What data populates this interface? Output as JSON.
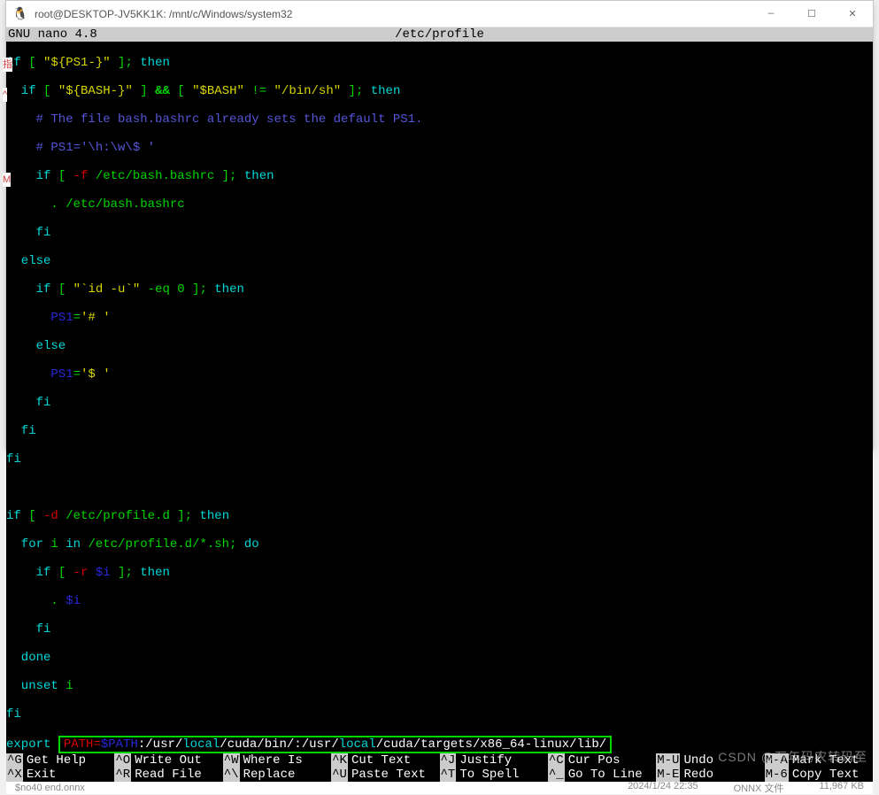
{
  "titlebar": {
    "icon": "🐧",
    "title": "root@DESKTOP-JV5KK1K: /mnt/c/Windows/system32",
    "min": "—",
    "max": "☐",
    "close": "✕"
  },
  "header": {
    "left": "  GNU nano 4.8",
    "center": "/etc/profile"
  },
  "code": {
    "l01_a": "if",
    "l01_b": " [ ",
    "l01_c": "\"${PS1-}\"",
    "l01_d": " ]; ",
    "l01_e": "then",
    "l02_a": "  if",
    "l02_b": " [ ",
    "l02_c": "\"${BASH-}\"",
    "l02_d": " ] ",
    "l02_e": "&&",
    "l02_f": " [ ",
    "l02_g": "\"$BASH\"",
    "l02_h": " != ",
    "l02_i": "\"/bin/sh\"",
    "l02_j": " ]; ",
    "l02_k": "then",
    "l03": "    # The file bash.bashrc already sets the default PS1.",
    "l04a": "    # PS1='\\h:\\w\\$ '",
    "l05_a": "    if",
    "l05_b": " [ ",
    "l05_c": "-f",
    "l05_d": " /etc/bash.bashrc ]; ",
    "l05_e": "then",
    "l06": "      . /etc/bash.bashrc",
    "l07": "    fi",
    "l08": "  else",
    "l09_a": "    if",
    "l09_b": " [ ",
    "l09_c": "\"`id -u`\"",
    "l09_d": " -eq 0 ]; ",
    "l09_e": "then",
    "l10_a": "      PS1",
    "l10_b": "=",
    "l10_c": "'# '",
    "l11": "    else",
    "l12_a": "      PS1",
    "l12_b": "=",
    "l12_c": "'$ '",
    "l13": "    fi",
    "l14": "  fi",
    "l15": "fi",
    "blank": " ",
    "l17_a": "if",
    "l17_b": " [ ",
    "l17_c": "-d",
    "l17_d": " /etc/profile.d ]; ",
    "l17_e": "then",
    "l18_a": "  for",
    "l18_b": " i ",
    "l18_c": "in",
    "l18_d": " /etc/profile.d/*.sh; ",
    "l18_e": "do",
    "l19_a": "    if",
    "l19_b": " [ ",
    "l19_c": "-r",
    "l19_d": " $i",
    "l19_e": " ]; ",
    "l19_f": "then",
    "l20_a": "      . ",
    "l20_b": "$i",
    "l21": "    fi",
    "l22": "  done",
    "l23_a": "  unset",
    "l23_b": " i",
    "l24": "fi",
    "l25_a": "export",
    "l25_b": " ",
    "l25_p1": "PATH=",
    "l25_p2": "$PATH",
    "l25_p3": ":/usr/",
    "l25_p4": "local",
    "l25_p5": "/cuda/bin/:/usr/",
    "l25_p6": "local",
    "l25_p7": "/cuda/targets/x86_64-linux/lib/"
  },
  "shortcuts": {
    "row1": [
      {
        "key": "^G",
        "label": "Get Help"
      },
      {
        "key": "^O",
        "label": "Write Out"
      },
      {
        "key": "^W",
        "label": "Where Is"
      },
      {
        "key": "^K",
        "label": "Cut Text"
      },
      {
        "key": "^J",
        "label": "Justify"
      },
      {
        "key": "^C",
        "label": "Cur Pos"
      },
      {
        "key": "M-U",
        "label": "Undo"
      },
      {
        "key": "M-A",
        "label": "Mark Text"
      }
    ],
    "row2": [
      {
        "key": "^X",
        "label": "Exit"
      },
      {
        "key": "^R",
        "label": "Read File"
      },
      {
        "key": "^\\",
        "label": "Replace"
      },
      {
        "key": "^U",
        "label": "Paste Text"
      },
      {
        "key": "^T",
        "label": "To Spell"
      },
      {
        "key": "^_",
        "label": "Go To Line"
      },
      {
        "key": "M-E",
        "label": "Redo"
      },
      {
        "key": "M-6",
        "label": "Copy Text"
      }
    ]
  },
  "statusbar": {
    "file": "$no40 end.onnx",
    "date": "2024/1/24 22:35",
    "type": "ONNX 文件",
    "size": "11,967 KB"
  },
  "side": {
    "m1": "指",
    "m2": "^",
    "m3": "M"
  },
  "watermark": "CSDN @万年码农转码至"
}
